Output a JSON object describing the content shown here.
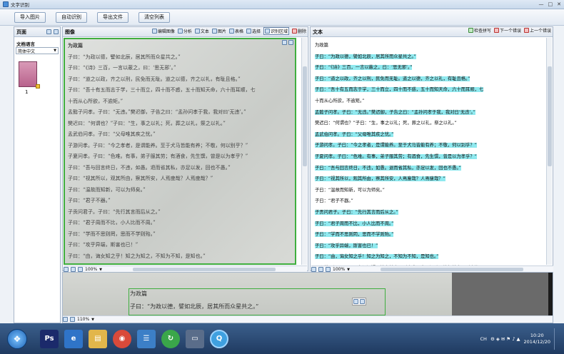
{
  "window": {
    "title": "文字识别",
    "min": "—",
    "max": "□",
    "close": "✕"
  },
  "toolbar": {
    "import": "导入图片",
    "auto": "自动识别",
    "export": "导出文件",
    "clear": "清空列表"
  },
  "left": {
    "header": "页面",
    "lang_label": "文档语言",
    "lang_value": "简体中文",
    "page_num": "1"
  },
  "image_panel": {
    "header": "图像",
    "tools": [
      "编辑图像",
      "分析",
      "文本",
      "图片",
      "表格",
      "选择",
      "识别区域",
      "删除"
    ],
    "lines": [
      "为政篇",
      "子曰：“为政以德，譬如北辰，居其所而众星共之。”",
      "子曰：“《诗》三百，一言以蔽之，曰：‘思无邪’。”",
      "子曰：“道之以政，齐之以刑，民免而无耻。道之以德，齐之以礼，有耻且格。”",
      "子曰：“吾十有五而志于学，三十而立，四十而不惑，五十而知天命，六十而耳顺，七",
      "十而从心所欲，不逾矩。”",
      "孟懿子问孝。子曰：“无违。”樊迟御，子告之曰：“孟孙问孝于我，我对曰‘无违’。”",
      "樊迟曰：“何谓也？”子曰：“生，事之以礼；死，葬之以礼，祭之以礼。”",
      "孟武伯问孝。子曰：“父母唯其疾之忧。”",
      "子游问孝。子曰：“今之孝者，是谓能养。至于犬马皆能有养；不敬，何以别乎？”",
      "子夏问孝。子曰：“色难。有事，弟子服其劳；有酒食，先生馔，曾是以为孝乎？”",
      "子曰：“吾与回言终日，不违，如愚。退而省其私，亦足以发，回也不愚。”",
      "子曰：“视其所以，观其所由，察其所安，人焉廋哉？人焉廋哉？”",
      "子曰：“温故而知新，可以为师矣。”",
      "子曰：“君子不器。”",
      "子贡问君子。子曰：“先行其言而后从之。”",
      "子曰：“君子周而不比，小人比而不周。”",
      "子曰：“学而不思则罔，思而不学则殆。”",
      "子曰：“攻乎异端，斯害也已！”",
      "子曰：“由，诲女知之乎！知之为知之，不知为不知，是知也。”",
      "子张学干禄。子曰：“多闻阙疑，慎言其余，则寡尤；多见阙殆，慎行其余，则寡悔。"
    ],
    "zoom": "100%"
  },
  "text_panel": {
    "header": "文本",
    "tools": [
      "检查拼写",
      "下一个错误",
      "上一个错误"
    ],
    "lines": [
      "为政篇",
      "子曰：“为政以德，譬如北辰，居其所而众星共之。”",
      "子曰：“《诗》三百，一言以蔽之，曰：‘思无邪’。”",
      "子曰：“道之以政，齐之以刑，民免而无耻。道之以德，齐之以礼，有耻且格。”",
      "子曰：“吾十有五而志于学，三十而立，四十而不惑，五十而知天命，六十而耳顺，七",
      "十而从心所欲，不逾矩。”",
      "孟懿子问孝。子曰：“无违。”樊迟御，子告之曰：“孟孙问孝于我，我对曰‘无违’。”",
      "樊迟曰：“何谓也？”子曰：“生，事之以礼；死，葬之以礼，祭之以礼。”",
      "孟武伯问孝。子曰：“父母唯其疾之忧。”",
      "子游问孝。子曰：“今之孝者，是谓能养。至于犬马皆能有养；不敬，何以别乎？”",
      "子夏问孝。子曰：“色难。有事，弟子服其劳；有酒食，先生馔，曾是以为孝乎？”",
      "子曰：“吾与回言终日，不违，如愚。退而省其私，亦足以发，回也不愚。”",
      "子曰：“视其所以，观其所由，察其所安，人焉廋哉？人焉廋哉？”",
      "子曰：“温故而知新，可以为师矣。”",
      "子曰：“君子不器。”",
      "子贡问君子。子曰：“先行其言而后从之。”",
      "子曰：“君子周而不比，小人比而不周。”",
      "子曰：“学而不思则罔，思而不学则殆。”",
      "子曰：“攻乎异端，斯害也已！”",
      "子曰：“由，诲女知之乎！知之为知之，不知为不知，是知也。”",
      "子张学干禄。子曰：“多闻阙疑，慎言其余，则寡尤；多见阙殆，慎行其余，则寡悔。"
    ],
    "zoom": "100%"
  },
  "zoom_panel": {
    "title": "为政篇",
    "line": "子曰：“为政以德，譬如北辰，居其所而众星共之。”",
    "zoom": "110%"
  },
  "taskbar": {
    "lang": "CH",
    "time": "10:20",
    "date": "2014/12/20"
  }
}
